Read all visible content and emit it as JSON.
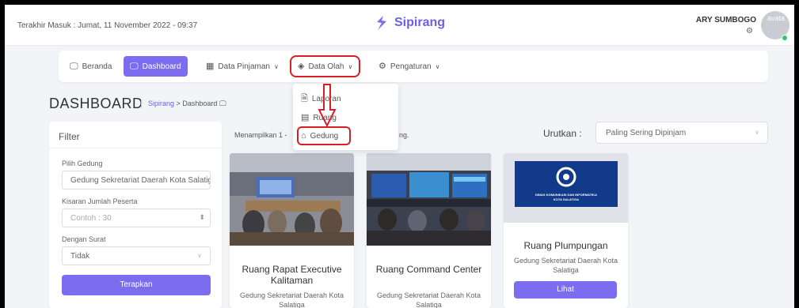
{
  "header": {
    "last_login": "Terakhir Masuk : Jumat, 11 November 2022 - 09:37",
    "brand": "Sipirang",
    "user_name": "ARY SUMBOGO",
    "avatar_text": "avata"
  },
  "nav": {
    "items": [
      {
        "label": "Beranda",
        "icon": "monitor-icon"
      },
      {
        "label": "Dashboard",
        "icon": "monitor-icon"
      },
      {
        "label": "Data Pinjaman",
        "icon": "calendar-icon"
      },
      {
        "label": "Data Olah",
        "icon": "layers-icon"
      },
      {
        "label": "Pengaturan",
        "icon": "gear-icon"
      }
    ],
    "caret": "∨"
  },
  "dropdown": {
    "items": [
      {
        "label": "Laporan",
        "icon": "file-icon"
      },
      {
        "label": "Ruang",
        "icon": "grid-icon"
      },
      {
        "label": "Gedung",
        "icon": "home-icon"
      }
    ]
  },
  "page": {
    "title": "DASHBOARD",
    "breadcrumb_root": "Sipirang",
    "breadcrumb_sep": ">",
    "breadcrumb_current": "Dashboard"
  },
  "filter": {
    "title": "Filter",
    "gedung_label": "Pilih Gedung",
    "gedung_value": "Gedung Sekretariat Daerah Kota Salatiga",
    "peserta_label": "Kisaran Jumlah Peserta",
    "peserta_placeholder": "Contoh : 30",
    "surat_label": "Dengan Surat",
    "surat_value": "Tidak",
    "apply_label": "Terapkan"
  },
  "results": {
    "info": "Menampilkan 1 -",
    "info_tail": "ng.",
    "sort_label": "Urutkan :",
    "sort_value": "Paling Sering Dipinjam"
  },
  "cards": [
    {
      "title": "Ruang Rapat Executive Kalitaman",
      "subtitle": "Gedung Sekretariat Daerah Kota Salatiga"
    },
    {
      "title": "Ruang Command Center",
      "subtitle": "Gedung Sekretariat Daerah Kota Salatiga"
    },
    {
      "title": "Ruang Plumpungan",
      "subtitle": "Gedung Sekretariat Daerah Kota Salatiga",
      "button": "Lihat",
      "logo_line1": "DINAS KOMUNIKASI DAN INFORMATIKA",
      "logo_line2": "KOTA SALATIGA"
    }
  ],
  "colors": {
    "accent": "#7b6cf0",
    "highlight": "#d61f26"
  }
}
